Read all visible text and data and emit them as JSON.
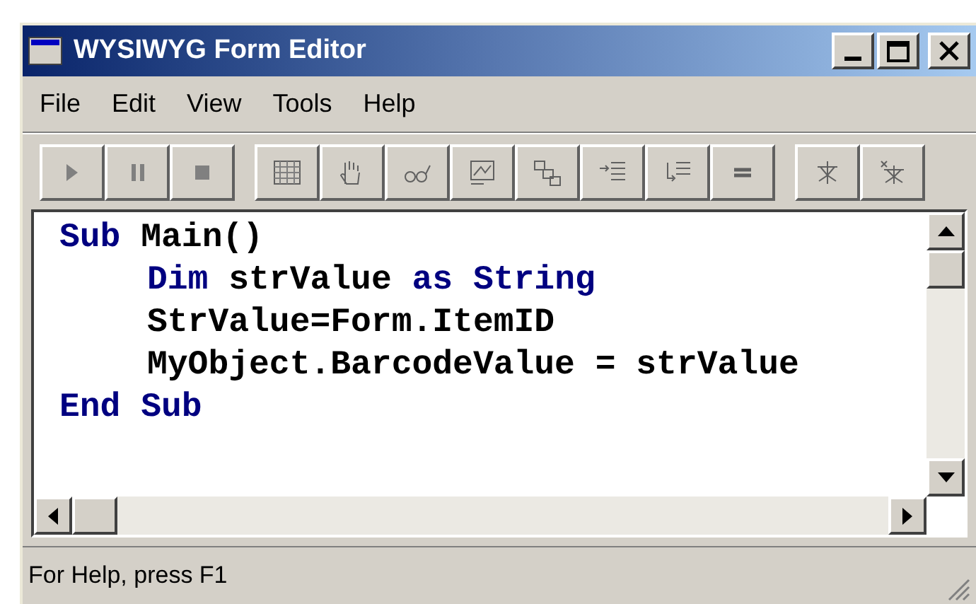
{
  "window": {
    "title": "WYSIWYG Form Editor"
  },
  "menu": [
    "File",
    "Edit",
    "View",
    "Tools",
    "Help"
  ],
  "code_lines": [
    {
      "indent": false,
      "tokens": [
        {
          "text": "Sub",
          "kind": "keyword"
        },
        {
          "text": " Main()",
          "kind": "plain"
        }
      ]
    },
    {
      "indent": true,
      "tokens": [
        {
          "text": "Dim",
          "kind": "keyword"
        },
        {
          "text": " strValue",
          "kind": "plain"
        },
        {
          "text": " as",
          "kind": "keyword"
        },
        {
          "text": " String",
          "kind": "keyword"
        }
      ]
    },
    {
      "indent": true,
      "tokens": [
        {
          "text": "StrValue=Form.ItemID",
          "kind": "plain"
        }
      ]
    },
    {
      "indent": true,
      "tokens": [
        {
          "text": "MyObject.BarcodeValue = strValue",
          "kind": "plain"
        }
      ]
    },
    {
      "indent": false,
      "tokens": [
        {
          "text": "End",
          "kind": "keyword"
        },
        {
          "text": " Sub",
          "kind": "keyword"
        }
      ]
    }
  ],
  "status_bar": {
    "text": "For Help, press F1"
  }
}
